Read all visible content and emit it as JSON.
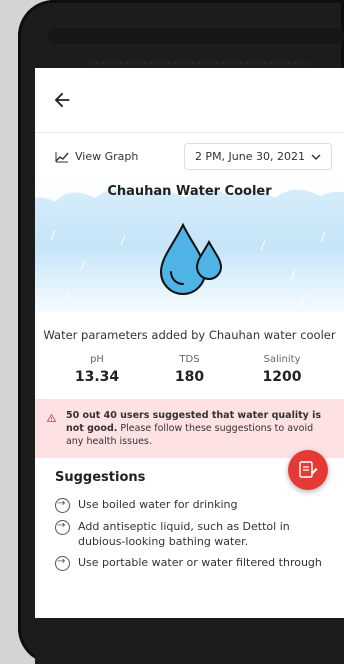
{
  "appbar": {
    "back_icon": "arrow-left-icon"
  },
  "toolbar": {
    "view_graph_label": "View Graph",
    "date_value": "2 PM, June 30, 2021"
  },
  "hero": {
    "title": "Chauhan Water Cooler"
  },
  "caption": "Water parameters added by Chauhan water cooler",
  "params": [
    {
      "label": "pH",
      "value": "13.34"
    },
    {
      "label": "TDS",
      "value": "180"
    },
    {
      "label": "Salinity",
      "value": "1200"
    }
  ],
  "alert": {
    "bold_text": "50 out 40 users suggested that water quality is not good.",
    "normal_text": " Please follow these suggestions to avoid any health issues."
  },
  "suggestions": {
    "heading": "Suggestions",
    "items": [
      "Use boiled water for drinking",
      "Add antiseptic liquid, such as Dettol in dubious-looking bathing water.",
      "Use portable water or water filtered through"
    ]
  },
  "colors": {
    "alert_bg": "#fde1e3",
    "fab": "#e53935",
    "hero_bg": "#c5e5f8"
  }
}
